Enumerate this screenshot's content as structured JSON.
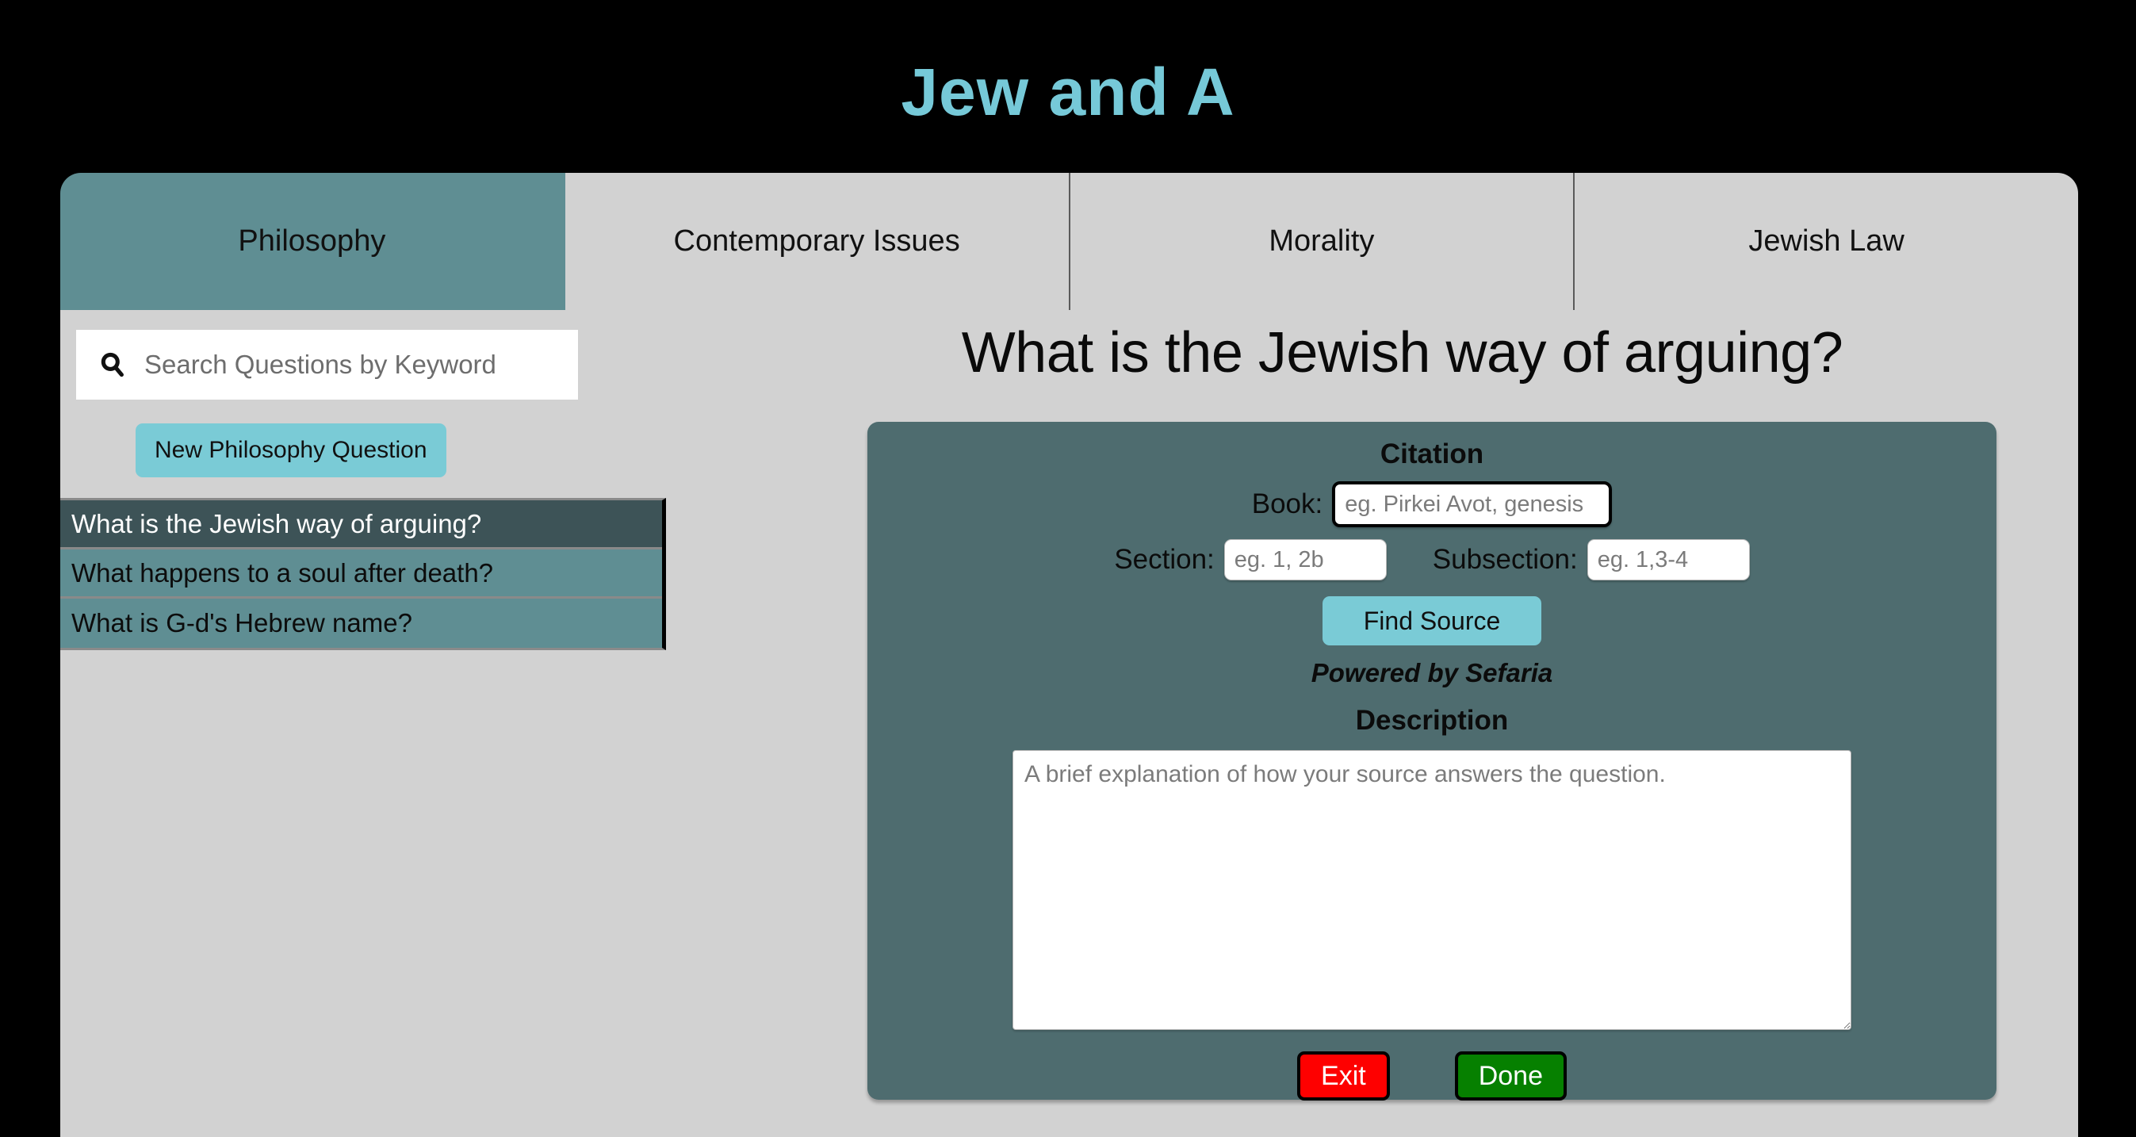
{
  "header": {
    "title": "Jew and A",
    "title_color": "#76c9d8",
    "background_color": "#000000"
  },
  "tabs": [
    {
      "label": "Philosophy",
      "active": true
    },
    {
      "label": "Contemporary Issues",
      "active": false
    },
    {
      "label": "Morality",
      "active": false
    },
    {
      "label": "Jewish Law",
      "active": false
    }
  ],
  "sidebar": {
    "search": {
      "icon": "search-icon",
      "value": "",
      "placeholder": "Search Questions by Keyword"
    },
    "new_question_button": "New Philosophy Question",
    "questions": [
      {
        "label": "What is the Jewish way of arguing?",
        "selected": true
      },
      {
        "label": "What happens to a soul after death?",
        "selected": false
      },
      {
        "label": "What is G-d's Hebrew name?",
        "selected": false
      }
    ]
  },
  "main": {
    "question_heading": "What is the Jewish way of arguing?",
    "citation": {
      "title": "Citation",
      "book_label": "Book:",
      "book_value": "",
      "book_placeholder": "eg. Pirkei Avot, genesis",
      "section_label": "Section:",
      "section_value": "",
      "section_placeholder": "eg. 1, 2b",
      "subsection_label": "Subsection:",
      "subsection_value": "",
      "subsection_placeholder": "eg. 1,3-4",
      "find_source_button": "Find Source",
      "powered_by": "Powered by Sefaria"
    },
    "description": {
      "title": "Description",
      "value": "",
      "placeholder": "A brief explanation of how your source answers the question."
    },
    "actions": {
      "exit_label": "Exit",
      "done_label": "Done"
    }
  },
  "colors": {
    "accent_teal": "#5f8e93",
    "panel_teal": "#4e6c6f",
    "light_teal": "#7acbd6",
    "selected_row": "#3d5357",
    "content_gray": "#d2d2d2",
    "exit_red": "#fe0000",
    "done_green": "#068000"
  }
}
